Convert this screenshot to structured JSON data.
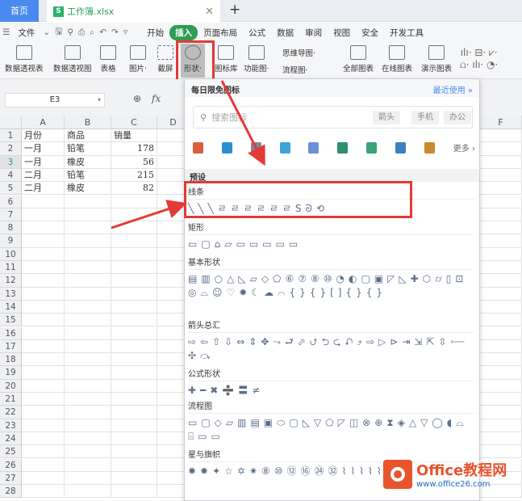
{
  "tabs": {
    "home": "首页",
    "file": "工作簿.xlsx",
    "file_icon": "S"
  },
  "menu": {
    "file": "文件",
    "items": [
      "开始",
      "插入",
      "页面布局",
      "公式",
      "数据",
      "审阅",
      "视图",
      "安全",
      "开发工具"
    ],
    "active": "插入"
  },
  "ribbon": [
    "数据透视表",
    "数据透视图",
    "表格",
    "图片·",
    "截屏",
    "形状·",
    "图标库",
    "功能图·",
    "全部图表",
    "在线图表",
    "演示图表"
  ],
  "ribbon_small": [
    "思维导图·",
    "流程图·"
  ],
  "formula": {
    "cell_ref": "E3",
    "fx": "fx"
  },
  "columns": [
    "A",
    "B",
    "C",
    "D",
    "F"
  ],
  "rows": [
    "1",
    "2",
    "3",
    "4",
    "5",
    "6",
    "7",
    "8",
    "9",
    "10",
    "11",
    "12",
    "13",
    "14",
    "15",
    "16",
    "17",
    "18",
    "19",
    "20",
    "21",
    "22",
    "23",
    "24",
    "25",
    "26",
    "27",
    "28"
  ],
  "table": [
    [
      "月份",
      "商品",
      "销量"
    ],
    [
      "一月",
      "铅笔",
      "178"
    ],
    [
      "一月",
      "橡皮",
      "56"
    ],
    [
      "二月",
      "铅笔",
      "215"
    ],
    [
      "二月",
      "橡皮",
      "82"
    ]
  ],
  "panel": {
    "title": "每日限免图标",
    "recent": "最近使用 »",
    "search_placeholder": "搜索图标",
    "tags": [
      "箭头",
      "手机",
      "办公"
    ],
    "more": "更多 ›",
    "icon_colors": [
      "#d9603b",
      "#2c8fd6",
      "#7a8a99",
      "#3fa3d8",
      "#6c8fd6",
      "#2d8f6a",
      "#3aa37a",
      "#3d7fc4",
      "#c98a2c"
    ],
    "preset": "预设",
    "sections": [
      {
        "title": "线条",
        "shapes": "╲╲╲ㄹㄹㄹㄹㄹㄹSᘐ⟲"
      },
      {
        "title": "矩形",
        "shapes": "▭▢⌂▱▭▭▭▭▭"
      },
      {
        "title": "基本形状",
        "shapes": "▤▥○△◺▱◇⬠⑥⑦⑧⑩◔◐▢▣◸◺✚⬡⌭▯⊡◎⌓☺♡✸☾☁⌒{}{}[]{}{}"
      },
      {
        "title": "箭头总汇",
        "shapes": "⇨⇦⇧⇩⇔⇕✥⤳⮐⬀⮍⮌⮎⮏⤴⇨▷⊳⇥⇲⇱⇳⬳✣⤼"
      },
      {
        "title": "公式形状",
        "shapes": "✚━✖➗〓≠"
      },
      {
        "title": "流程图",
        "shapes": "▭▢◇▱▥▤▣⬭▢◺▽⬠◸◫⊗⊕⧗◈△▽◯◖⌓⌸▭▭"
      },
      {
        "title": "星与旗帜",
        "shapes": "✹✸✦☆✡✷⑧⑩⑫⑯㉔㉜⌇⌇⌇⌇⌇"
      }
    ]
  },
  "watermark": {
    "name": "Office教程网",
    "url": "www.office26.com"
  }
}
